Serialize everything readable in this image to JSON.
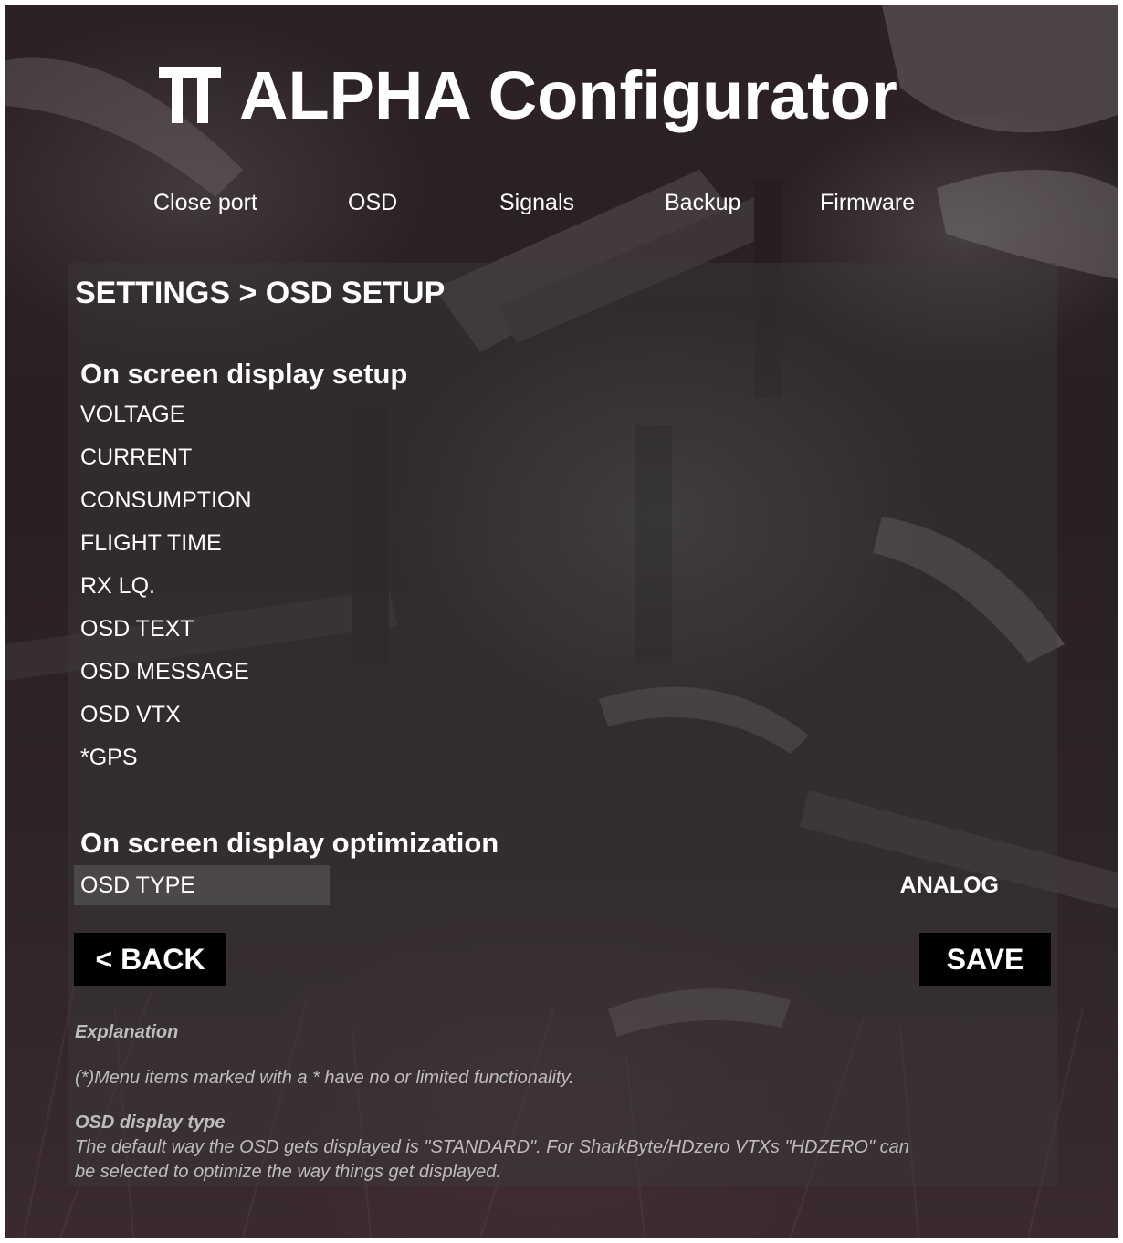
{
  "app": {
    "title": "ALPHA Configurator",
    "logo_icon": "tt-logo-icon"
  },
  "nav": {
    "items": [
      {
        "label": "Close port"
      },
      {
        "label": "OSD"
      },
      {
        "label": "Signals"
      },
      {
        "label": "Backup"
      },
      {
        "label": "Firmware"
      }
    ]
  },
  "page": {
    "breadcrumb": "SETTINGS > OSD SETUP",
    "setup_title": "On screen display setup",
    "setup_items": [
      {
        "label": "VOLTAGE"
      },
      {
        "label": "CURRENT"
      },
      {
        "label": "CONSUMPTION"
      },
      {
        "label": "FLIGHT TIME"
      },
      {
        "label": "RX LQ."
      },
      {
        "label": "OSD TEXT"
      },
      {
        "label": "OSD MESSAGE"
      },
      {
        "label": "OSD VTX"
      },
      {
        "label": "*GPS"
      }
    ],
    "optimization_title": "On screen display optimization",
    "osd_type": {
      "label": "OSD TYPE",
      "value": "ANALOG"
    },
    "back_label": "< BACK",
    "save_label": "SAVE"
  },
  "explanation": {
    "heading": "Explanation",
    "note": "(*)Menu items marked with a * have no or limited functionality.",
    "osd_type_heading": "OSD display type",
    "osd_type_text_line1": "The default way the OSD gets displayed is \"STANDARD\". For SharkByte/HDzero VTXs \"HDZERO\" can",
    "osd_type_text_line2": "be selected to optimize the way things get displayed."
  },
  "colors": {
    "text": "#ffffff",
    "muted_text": "#bdbdbd",
    "button_bg": "#000000",
    "panel_bg": "rgba(60,60,60,0.42)"
  }
}
